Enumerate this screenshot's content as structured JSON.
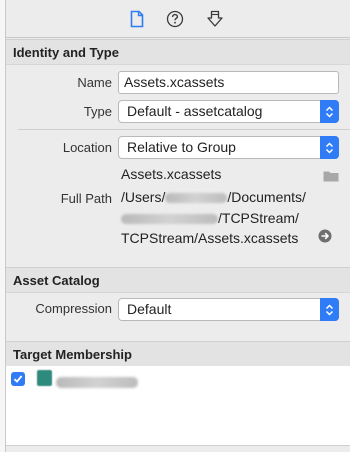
{
  "toolbar": {
    "icons": [
      "file-inspector-icon",
      "quick-help-icon",
      "identity-inspector-icon"
    ],
    "colors": {
      "active": "#2f7cf6",
      "inactive": "#3a3a3a"
    }
  },
  "identity": {
    "header": "Identity and Type",
    "name_label": "Name",
    "name_value": "Assets.xcassets",
    "type_label": "Type",
    "type_value": "Default - assetcatalog",
    "location_label": "Location",
    "location_value": "Relative to Group",
    "location_filename": "Assets.xcassets",
    "fullpath_label": "Full Path",
    "fullpath_line1_a": "/Users/",
    "fullpath_line1_b": "/Documents/",
    "fullpath_line2_b": "/TCPStream/",
    "fullpath_line3": "TCPStream/Assets.xcassets"
  },
  "asset_catalog": {
    "header": "Asset Catalog",
    "compression_label": "Compression",
    "compression_value": "Default"
  },
  "target_membership": {
    "header": "Target Membership",
    "checked": true
  },
  "colors": {
    "accent": "#2f7cf6",
    "background": "#ececec",
    "target_icon": "#2e8a7d"
  }
}
